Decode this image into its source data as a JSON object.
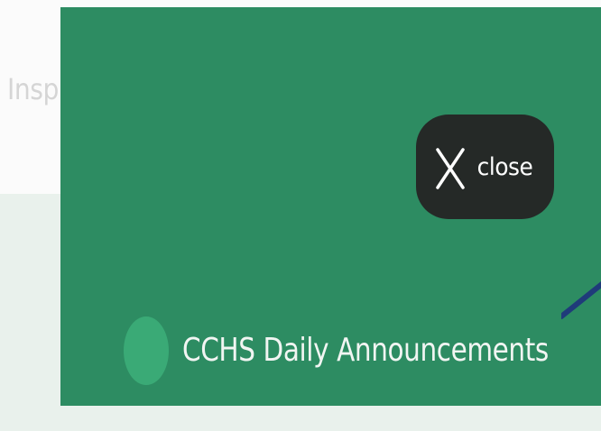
{
  "background": {
    "title_fragment": "Insp"
  },
  "panel": {
    "color": "#2d8c62",
    "close_button": {
      "label": "close",
      "icon": "x-icon",
      "color": "#252927"
    },
    "channel": {
      "name": "CCHS Daily Announcements",
      "avatar_color": "#3aaa76"
    }
  },
  "colors": {
    "pointer": "#1f3b7a",
    "panel": "#2d8c62",
    "close_bg": "#252927"
  }
}
